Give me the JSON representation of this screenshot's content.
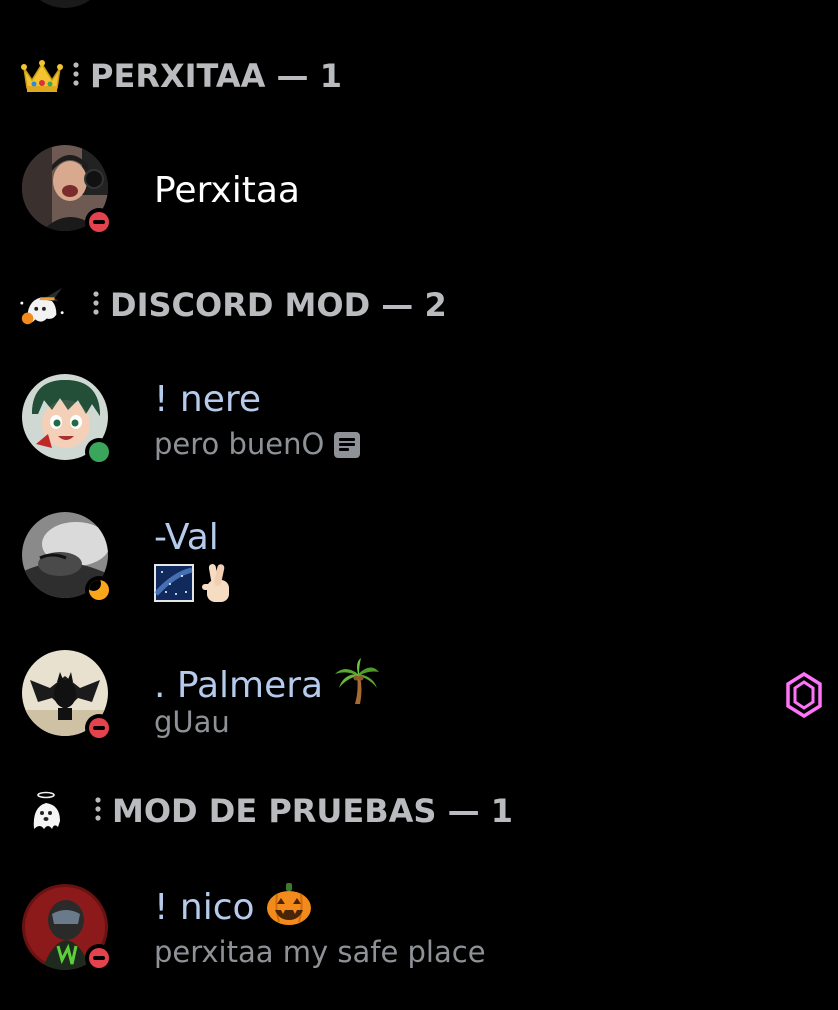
{
  "sections": [
    {
      "emoji": "crown-emoji",
      "title": "PERXITAA — 1"
    },
    {
      "emoji": "witch-ghost-emoji",
      "title": "DISCORD MOD — 2"
    },
    {
      "emoji": "ghost-emoji",
      "title": "MOD DE PRUEBAS — 1"
    }
  ],
  "members": [
    {
      "name": "Perxitaa",
      "activity": "",
      "status": "dnd",
      "name_color": "#ffffff"
    },
    {
      "name": "! nere",
      "activity": "pero buenO",
      "status": "online",
      "name_color": "#b6cbeb"
    },
    {
      "name": "-Val",
      "activity": "",
      "status": "idle",
      "name_color": "#b6cbeb"
    },
    {
      "name": ". Palmera",
      "activity": "gUau",
      "status": "dnd",
      "name_color": "#b6cbeb"
    },
    {
      "name": "! nico",
      "activity": "perxitaa my safe place",
      "status": "dnd",
      "name_color": "#b6cbeb"
    }
  ],
  "icons": {
    "nere_activity_icon": "note-icon",
    "val_activity_emojis": [
      "night-sky-emoji",
      "crossed-fingers-emoji"
    ],
    "palmera_name_emoji": "palm-tree-emoji",
    "nico_name_emoji": "jack-o-lantern-emoji",
    "palmera_badge": "nitro-boost-icon"
  },
  "colors": {
    "background": "#000000",
    "section_title": "#b9bbbe",
    "role_name": "#b6cbeb",
    "activity_text": "#8e9297",
    "dnd": "#e4424d",
    "online": "#3ba55c",
    "idle": "#faa61a",
    "boost": "#ff73fa"
  }
}
